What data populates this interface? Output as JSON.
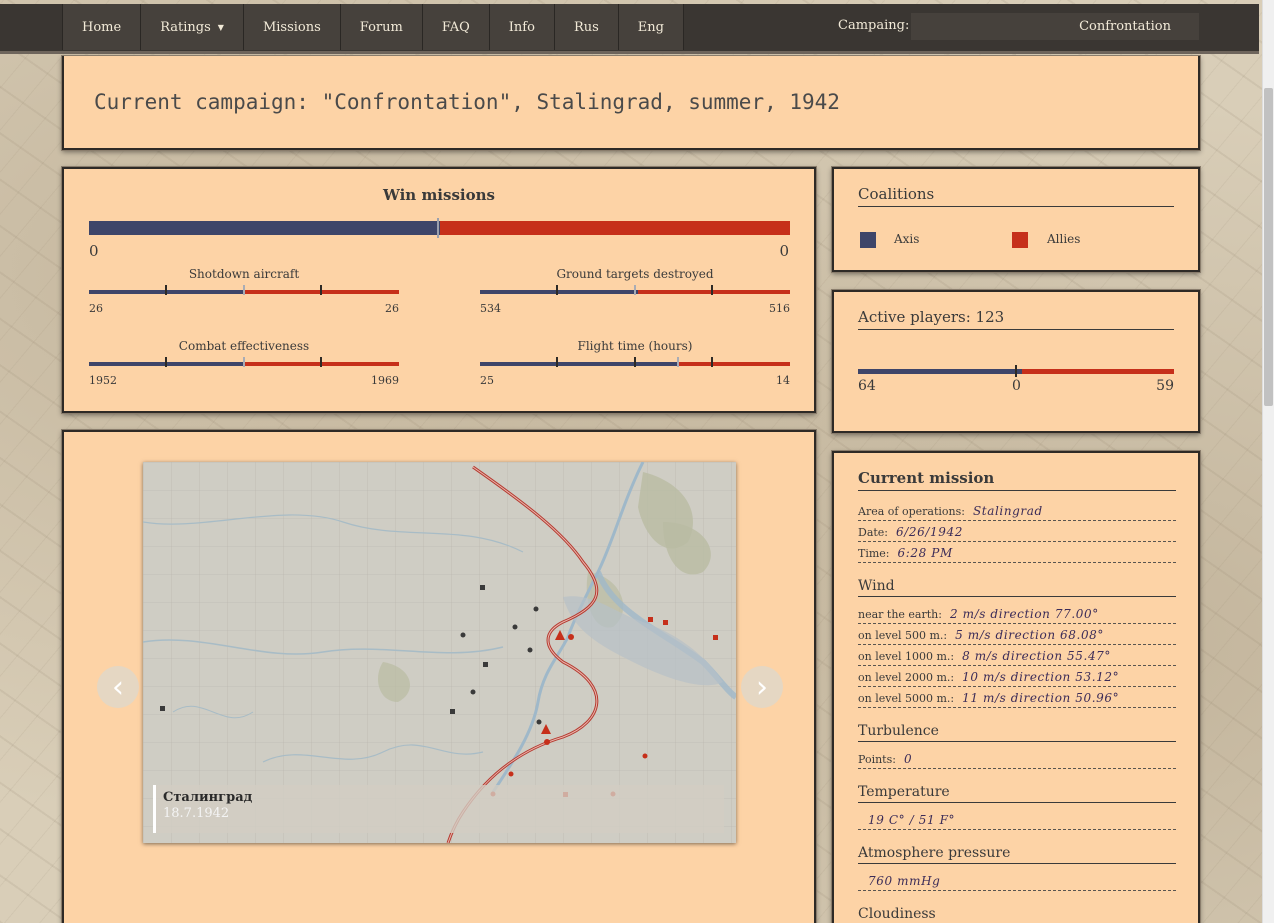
{
  "nav": {
    "items": [
      "Home",
      "Ratings",
      "Missions",
      "Forum",
      "FAQ",
      "Info",
      "Rus",
      "Eng"
    ],
    "campaign_label": "Campaing:",
    "campaign_value": "Confrontation"
  },
  "header": {
    "title": "Current campaign: \"Confrontation\", Stalingrad, summer, 1942"
  },
  "win": {
    "title": "Win missions",
    "left": "0",
    "right": "0",
    "axis_fraction": 0.5,
    "stats": [
      {
        "title": "Shotdown aircraft",
        "axis": "26",
        "allies": "26",
        "axis_fraction": 0.5
      },
      {
        "title": "Ground targets destroyed",
        "axis": "534",
        "allies": "516",
        "axis_fraction": 0.51
      },
      {
        "title": "Combat effectiveness",
        "axis": "1952",
        "allies": "1969",
        "axis_fraction": 0.5
      },
      {
        "title": "Flight time (hours)",
        "axis": "25",
        "allies": "14",
        "axis_fraction": 0.64
      }
    ]
  },
  "coalitions": {
    "title": "Coalitions",
    "axis": "Axis",
    "allies": "Allies",
    "axis_color": "#3e4569",
    "allies_color": "#c62f1a"
  },
  "players": {
    "title": "Active players: 123",
    "axis": "64",
    "middle": "0",
    "allies": "59",
    "axis_fraction": 0.52
  },
  "map": {
    "caption_title": "Сталинград",
    "caption_date": "18.7.1942",
    "prev_icon": "‹",
    "next_icon": "›"
  },
  "mission": {
    "title": "Current mission",
    "area_label": "Area of operations:",
    "area_value": "Stalingrad",
    "date_label": "Date:",
    "date_value": "6/26/1942",
    "time_label": "Time:",
    "time_value": "6:28 PM",
    "wind_title": "Wind",
    "wind": [
      {
        "label": "near the earth:",
        "value": "2 m/s direction 77.00°"
      },
      {
        "label": "on level 500 m.:",
        "value": "5 m/s direction 68.08°"
      },
      {
        "label": "on level 1000 m.:",
        "value": "8 m/s direction 55.47°"
      },
      {
        "label": "on level 2000 m.:",
        "value": "10 m/s direction 53.12°"
      },
      {
        "label": "on level 5000 m.:",
        "value": "11 m/s direction 50.96°"
      }
    ],
    "turbulence_title": "Turbulence",
    "turbulence_label": "Points:",
    "turbulence_value": "0",
    "temperature_title": "Temperature",
    "temperature_value": "19 C° / 51 F°",
    "pressure_title": "Atmosphere pressure",
    "pressure_value": "760 mmHg",
    "cloudiness_title": "Cloudiness"
  }
}
